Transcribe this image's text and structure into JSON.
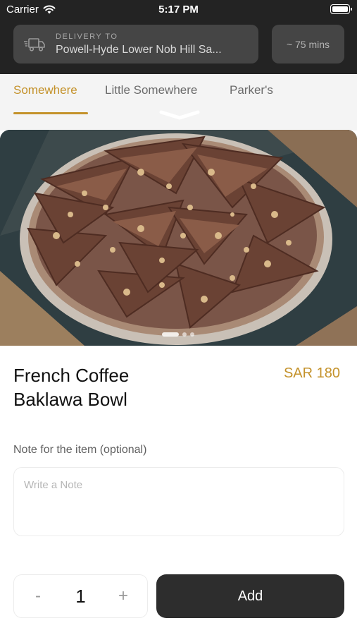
{
  "status_bar": {
    "carrier": "Carrier",
    "time": "5:17 PM"
  },
  "delivery": {
    "label": "DELIVERY TO",
    "address": "Powell-Hyde Lower Nob Hill Sa...",
    "eta": "~ 75 mins"
  },
  "tabs": [
    {
      "label": "Somewhere",
      "active": true
    },
    {
      "label": "Little Somewhere",
      "active": false
    },
    {
      "label": "Parker's",
      "active": false
    }
  ],
  "product": {
    "title_line1": "French Coffee",
    "title_line2": "Baklawa Bowl",
    "price": "SAR 180",
    "image_pager": {
      "count": 3,
      "active_index": 0
    }
  },
  "note": {
    "label": "Note for the item (optional)",
    "placeholder": "Write a Note",
    "value": ""
  },
  "quantity": {
    "minus": "-",
    "value": "1",
    "plus": "+"
  },
  "actions": {
    "add_label": "Add"
  },
  "colors": {
    "accent": "#c4922b",
    "header_bg": "#232323",
    "button_dark": "#2d2d2d"
  }
}
